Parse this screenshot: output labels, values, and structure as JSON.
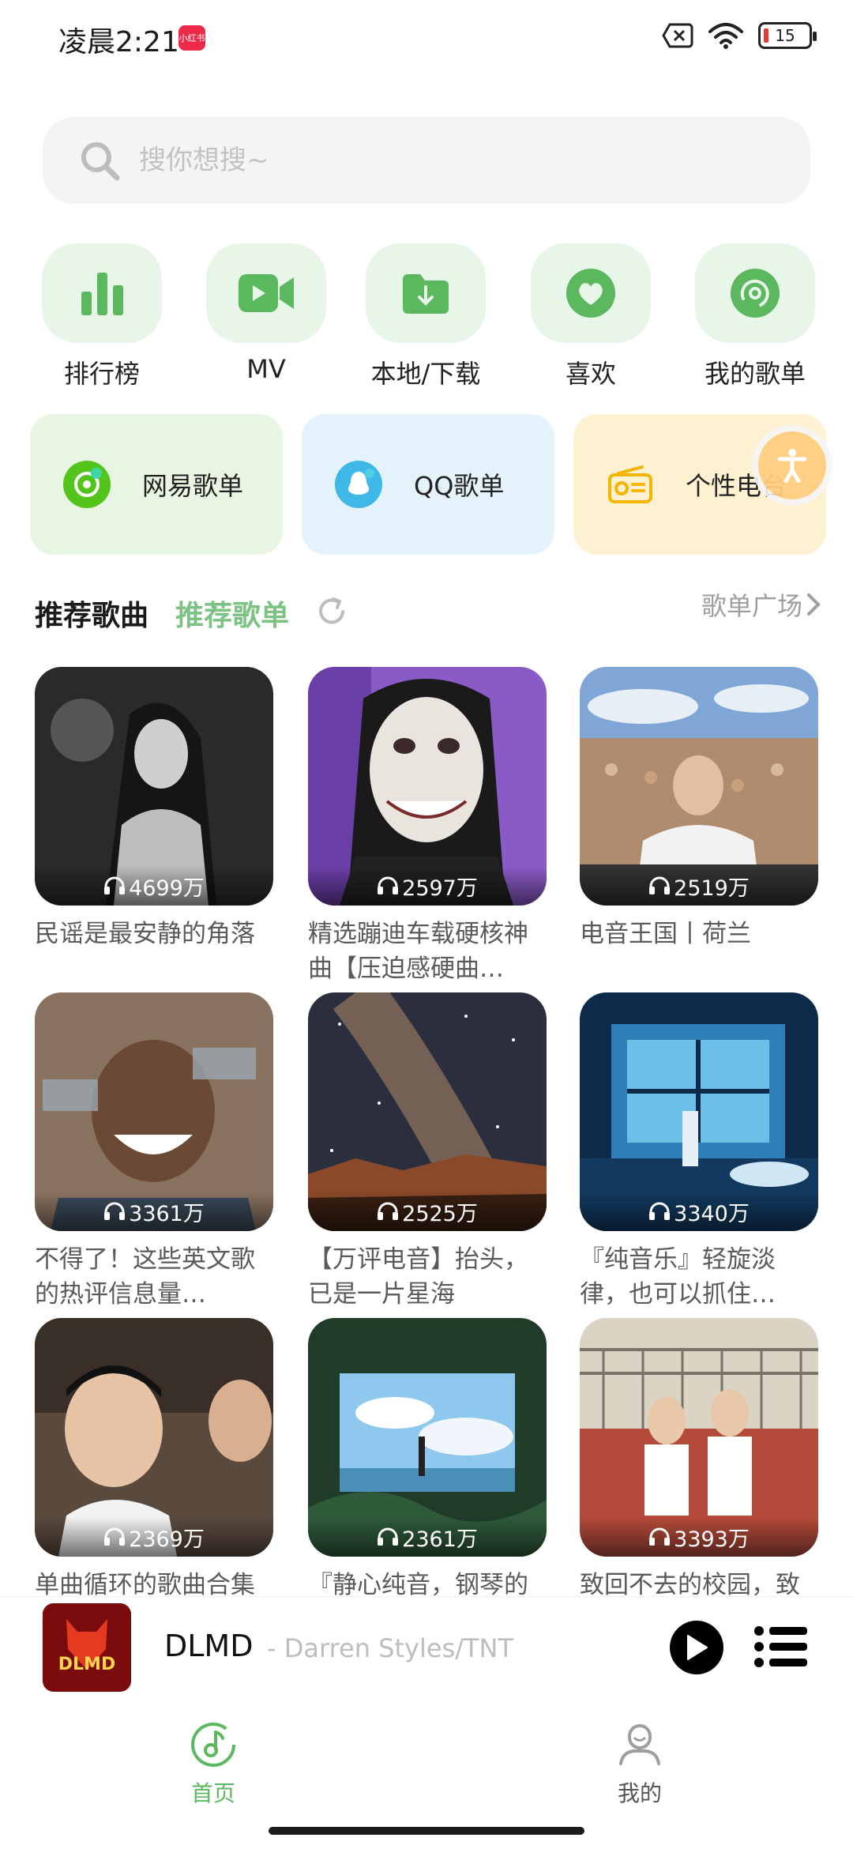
{
  "status_bar": {
    "time": "凌晨2:21",
    "app_badge": "小红书",
    "battery": "15"
  },
  "search": {
    "placeholder": "搜你想搜~"
  },
  "quick_nav": [
    {
      "label": "排行榜",
      "icon": "chart-bars-icon"
    },
    {
      "label": "MV",
      "icon": "video-camera-icon"
    },
    {
      "label": "本地/下载",
      "icon": "folder-download-icon"
    },
    {
      "label": "喜欢",
      "icon": "heart-icon"
    },
    {
      "label": "我的歌单",
      "icon": "disc-icon"
    }
  ],
  "sources": [
    {
      "label": "网易歌单",
      "icon": "netease-icon",
      "bg": "#e8f5e3"
    },
    {
      "label": "QQ歌单",
      "icon": "qq-icon",
      "bg": "#e3f2fb"
    },
    {
      "label": "个性电台",
      "icon": "radio-icon",
      "bg": "#fdf1d2"
    }
  ],
  "section": {
    "tab_songs": "推荐歌曲",
    "tab_playlists": "推荐歌单",
    "square_link": "歌单广场"
  },
  "playlists": [
    {
      "count": "4699万",
      "title": "民谣是最安静的角落"
    },
    {
      "count": "2597万",
      "title": "精选蹦迪车载硬核神曲【压迫感硬曲…"
    },
    {
      "count": "2519万",
      "title": "电音王国丨荷兰"
    },
    {
      "count": "3361万",
      "title": "不得了！这些英文歌的热评信息量…"
    },
    {
      "count": "2525万",
      "title": "【万评电音】抬头，已是一片星海"
    },
    {
      "count": "3340万",
      "title": "『纯音乐』轻旋淡律，也可以抓住…"
    },
    {
      "count": "2369万",
      "title": "单曲循环的歌曲合集"
    },
    {
      "count": "2361万",
      "title": "『静心纯音，钢琴的"
    },
    {
      "count": "3393万",
      "title": "致回不去的校园，致"
    }
  ],
  "player": {
    "title": "DLMD",
    "artist": "- Darren Styles/TNT",
    "cover_text": "DLMD"
  },
  "bottom_nav": {
    "home": "首页",
    "mine": "我的"
  },
  "colors": {
    "accent": "#5cb85f",
    "accent_light": "#e8f5e9"
  }
}
